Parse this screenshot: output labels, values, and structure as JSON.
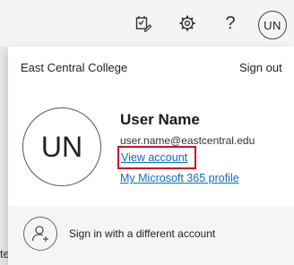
{
  "topbar": {
    "icons": [
      "task-edit-icon",
      "gear-icon",
      "help-icon"
    ],
    "help_glyph": "?",
    "user_initials": "UN"
  },
  "background": {
    "partial_text": "te"
  },
  "account_panel": {
    "org_name": "East Central College",
    "sign_out_label": "Sign out",
    "initials": "UN",
    "user_name": "User Name",
    "email": "user.name@eastcentral.edu",
    "view_account_label": "View account",
    "profile_link_label": "My Microsoft 365 profile",
    "add_account_label": "Sign in with a different account",
    "highlight_color": "#c8102e",
    "link_color": "#0f6cbd"
  }
}
